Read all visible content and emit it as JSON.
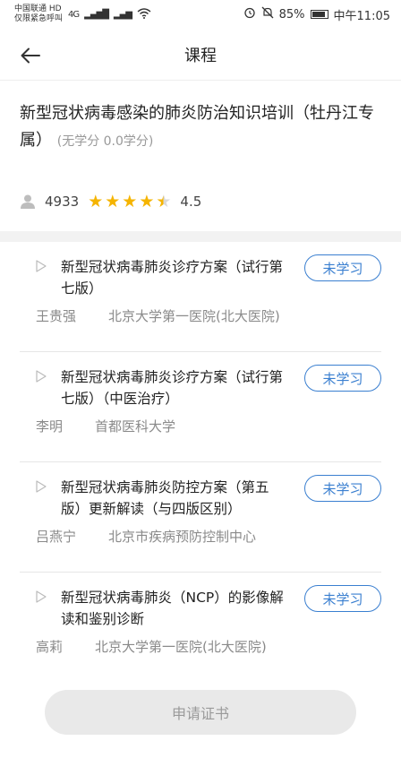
{
  "status_bar": {
    "carrier_line1": "中国联通 HD",
    "carrier_line2": "仅限紧急呼叫",
    "network": "4G",
    "battery_percent": "85%",
    "time": "中午11:05"
  },
  "nav": {
    "title": "课程",
    "back_icon": "arrow-left-icon"
  },
  "course": {
    "title": "新型冠状病毒感染的肺炎防治知识培训（牡丹江专属）",
    "credit": "(无学分 0.0学分)",
    "learners": "4933",
    "rating": 4.5,
    "rating_label": "4.5"
  },
  "lessons": [
    {
      "title": "新型冠状病毒肺炎诊疗方案（试行第七版）",
      "status": "未学习",
      "teacher": "王贵强",
      "institution": "北京大学第一医院(北大医院)"
    },
    {
      "title": "新型冠状病毒肺炎诊疗方案（试行第七版）（中医治疗）",
      "status": "未学习",
      "teacher": "李明",
      "institution": "首都医科大学"
    },
    {
      "title": "新型冠状病毒肺炎防控方案（第五版）更新解读（与四版区别）",
      "status": "未学习",
      "teacher": "吕燕宁",
      "institution": "北京市疾病预防控制中心"
    },
    {
      "title": "新型冠状病毒肺炎（NCP）的影像解读和鉴别诊断",
      "status": "未学习",
      "teacher": "高莉",
      "institution": "北京大学第一医院(北大医院)"
    }
  ],
  "footer": {
    "apply_label": "申请证书"
  },
  "colors": {
    "accent": "#3a7fd0",
    "star": "#f5b400",
    "muted": "#8a8a8a"
  }
}
